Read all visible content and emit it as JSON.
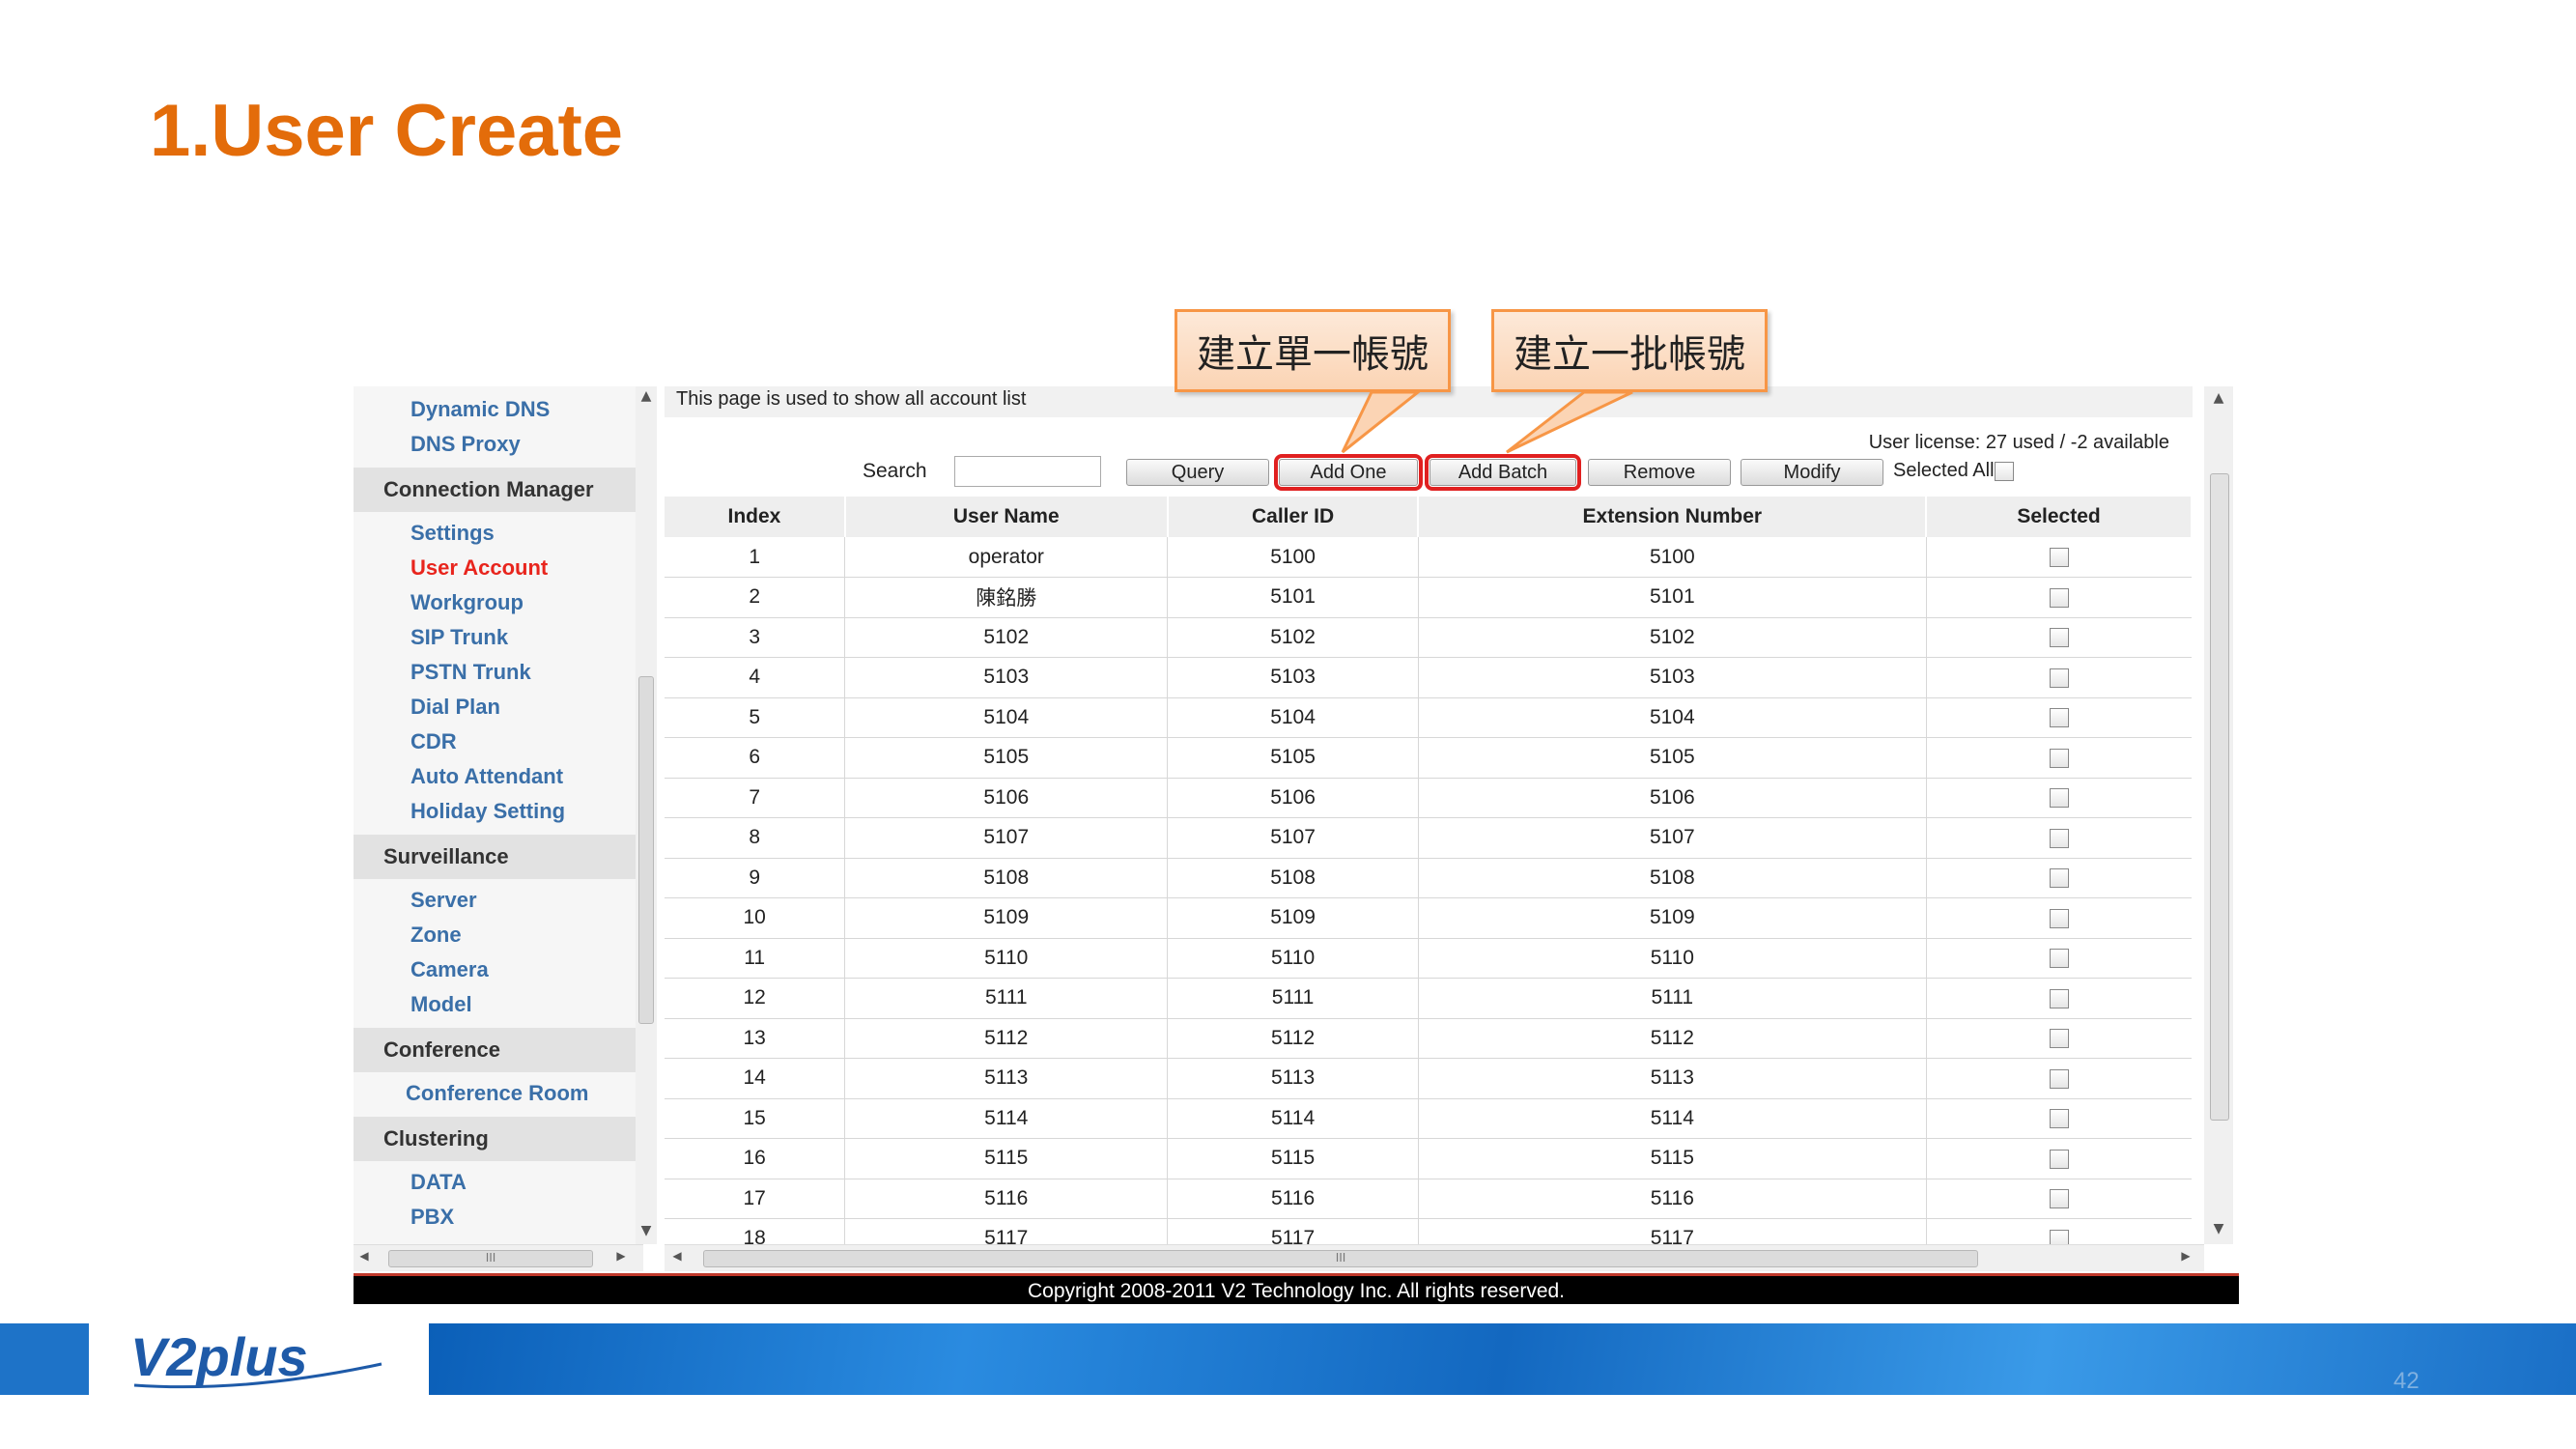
{
  "slide": {
    "title": "1.User Create",
    "page_number": "42"
  },
  "callouts": [
    {
      "text": "建立單一帳號"
    },
    {
      "text": "建立一批帳號"
    }
  ],
  "nav": {
    "items_top": [
      "Dynamic DNS",
      "DNS Proxy"
    ],
    "sections": [
      {
        "label": "Connection Manager",
        "items": [
          "Settings",
          "User Account",
          "Workgroup",
          "SIP Trunk",
          "PSTN Trunk",
          "Dial Plan",
          "CDR",
          "Auto Attendant",
          "Holiday Setting"
        ]
      },
      {
        "label": "Surveillance",
        "items": [
          "Server",
          "Zone",
          "Camera",
          "Model"
        ]
      },
      {
        "label": "Conference",
        "items": [
          "Conference Room"
        ]
      },
      {
        "label": "Clustering",
        "items": [
          "DATA",
          "PBX"
        ]
      }
    ],
    "active_item": "User Account"
  },
  "main": {
    "intro": "This page is used to show all account list",
    "license": "User license: 27 used / -2 available",
    "search_label": "Search",
    "search_value": "",
    "buttons": {
      "query": "Query",
      "add_one": "Add One",
      "add_batch": "Add Batch",
      "remove": "Remove",
      "modify": "Modify"
    },
    "selected_all_label": "Selected All"
  },
  "table": {
    "columns": [
      "Index",
      "User Name",
      "Caller ID",
      "Extension Number",
      "Selected"
    ],
    "rows": [
      [
        "1",
        "operator",
        "5100",
        "5100"
      ],
      [
        "2",
        "陳銘勝",
        "5101",
        "5101"
      ],
      [
        "3",
        "5102",
        "5102",
        "5102"
      ],
      [
        "4",
        "5103",
        "5103",
        "5103"
      ],
      [
        "5",
        "5104",
        "5104",
        "5104"
      ],
      [
        "6",
        "5105",
        "5105",
        "5105"
      ],
      [
        "7",
        "5106",
        "5106",
        "5106"
      ],
      [
        "8",
        "5107",
        "5107",
        "5107"
      ],
      [
        "9",
        "5108",
        "5108",
        "5108"
      ],
      [
        "10",
        "5109",
        "5109",
        "5109"
      ],
      [
        "11",
        "5110",
        "5110",
        "5110"
      ],
      [
        "12",
        "5111",
        "5111",
        "5111"
      ],
      [
        "13",
        "5112",
        "5112",
        "5112"
      ],
      [
        "14",
        "5113",
        "5113",
        "5113"
      ],
      [
        "15",
        "5114",
        "5114",
        "5114"
      ],
      [
        "16",
        "5115",
        "5115",
        "5115"
      ],
      [
        "17",
        "5116",
        "5116",
        "5116"
      ],
      [
        "18",
        "5117",
        "5117",
        "5117"
      ]
    ]
  },
  "footer": {
    "copyright": "Copyright 2008-2011 V2 Technology Inc. All rights reserved."
  },
  "colors": {
    "title_orange": "#e36c0a",
    "nav_link": "#3a6fa8",
    "nav_active": "#e8251d",
    "highlight_red": "#e02020",
    "banner_blue": "#1e73c8"
  },
  "logo": {
    "text": "V2plus"
  }
}
